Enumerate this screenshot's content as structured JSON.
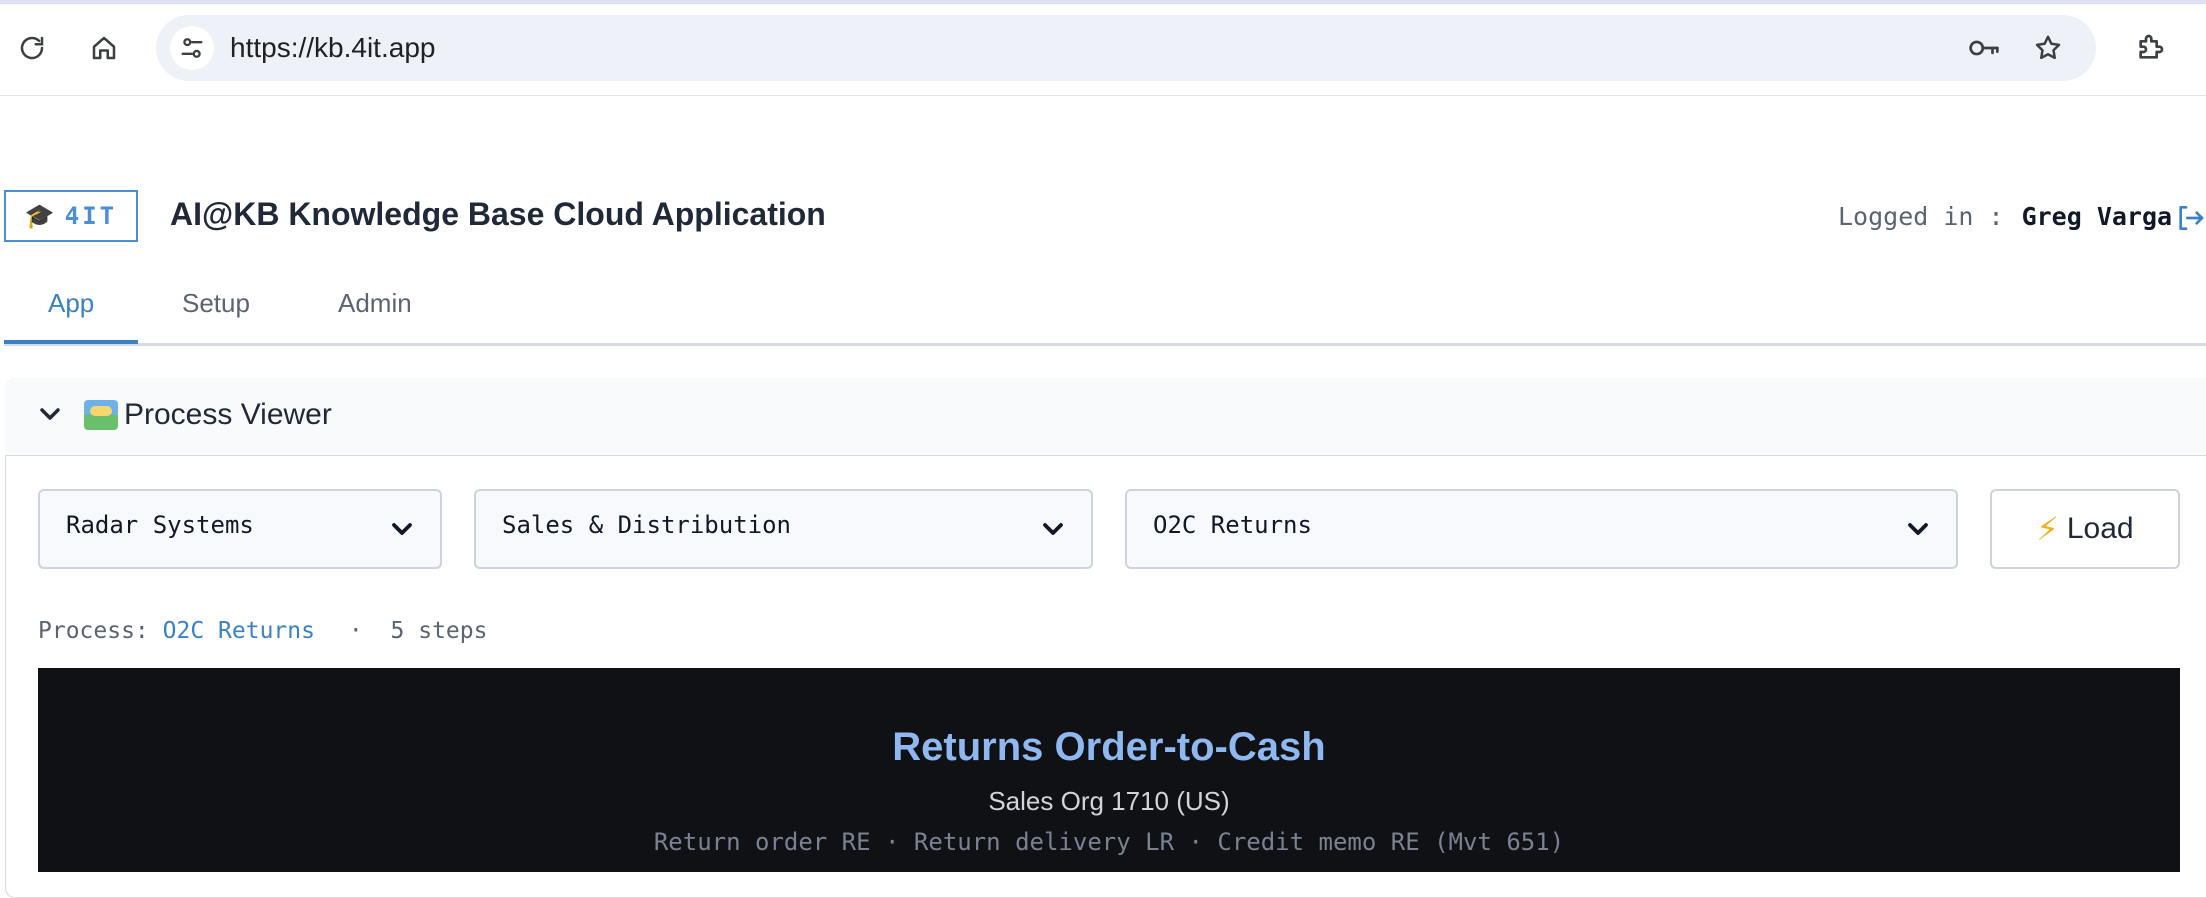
{
  "browser": {
    "url": "https://kb.4it.app"
  },
  "header": {
    "brand_text": "4IT",
    "title": "AI@KB Knowledge Base Cloud Application",
    "logged_in_label": "Logged in :",
    "user_name": "Greg Varga"
  },
  "tabs": [
    {
      "label": "App",
      "active": true
    },
    {
      "label": "Setup",
      "active": false
    },
    {
      "label": "Admin",
      "active": false
    }
  ],
  "panel": {
    "title": "Process Viewer",
    "selects": [
      {
        "value": "Radar Systems"
      },
      {
        "value": "Sales & Distribution"
      },
      {
        "value": "O2C Returns"
      }
    ],
    "load_label": "Load",
    "process_label": "Process:",
    "process_name": "O2C Returns",
    "separator": "·",
    "steps_text": "5 steps"
  },
  "diagram": {
    "title": "Returns Order-to-Cash",
    "subtitle": "Sales Org 1710 (US)",
    "description": "Return order RE · Return delivery LR · Credit memo RE (Mvt 651)"
  },
  "colors": {
    "accent": "#3b82c4",
    "brand_border": "#4a8fd6",
    "diagram_bg": "#0f1115",
    "diagram_title": "#8fb8f0",
    "bolt": "#f2b01e"
  },
  "icons": {
    "reload": "reload-icon",
    "home": "home-icon",
    "site_settings": "tune-icon",
    "password": "key-icon",
    "bookmark": "star-icon",
    "extensions": "puzzle-icon",
    "logout": "logout-icon",
    "collapse": "chevron-down-icon",
    "panel": "map-emoji-icon",
    "load": "lightning-icon",
    "brand": "graduation-cap-icon"
  }
}
